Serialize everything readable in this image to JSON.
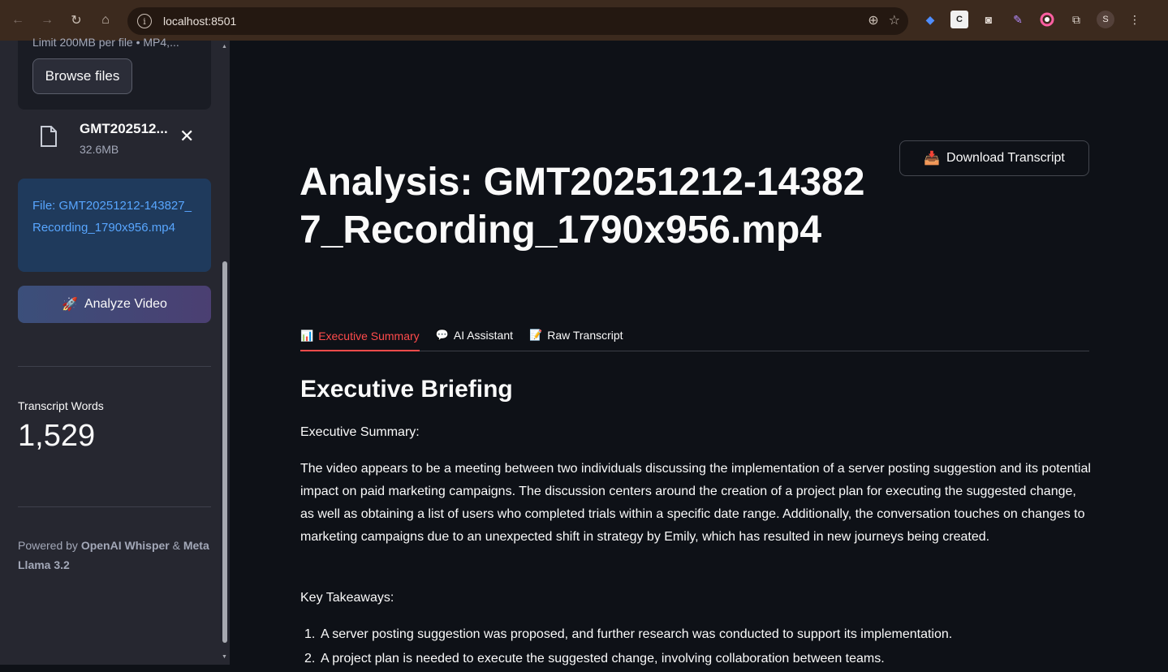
{
  "browser": {
    "url": "localhost:8501",
    "profile_initial": "S"
  },
  "sidebar": {
    "upload_limit": "Limit 200MB per file • MP4,...",
    "browse_label": "Browse files",
    "file_name": "GMT202512...",
    "file_size": "32.6MB",
    "file_info": "File: GMT20251212-143827_Recording_1790x956.mp4",
    "analyze_label": "Analyze Video",
    "metric_label": "Transcript Words",
    "metric_value": "1,529",
    "powered_prefix": "Powered by ",
    "powered_bold1": "OpenAI Whisper",
    "powered_mid": " & ",
    "powered_bold2": "Meta Llama 3.2"
  },
  "main": {
    "download_label": "Download Transcript",
    "title": "Analysis: GMT20251212-143827_Recording_1790x956.mp4",
    "tabs": [
      {
        "label": "Executive Summary",
        "active": true
      },
      {
        "label": "AI Assistant",
        "active": false
      },
      {
        "label": "Raw Transcript",
        "active": false
      }
    ],
    "section_title": "Executive Briefing",
    "summary_heading": "Executive Summary:",
    "summary_paragraph": "The video appears to be a meeting between two individuals discussing the implementation of a server posting suggestion and its potential impact on paid marketing campaigns. The discussion centers around the creation of a project plan for executing the suggested change, as well as obtaining a list of users who completed trials within a specific date range. Additionally, the conversation touches on changes to marketing campaigns due to an unexpected shift in strategy by Emily, which has resulted in new journeys being created.",
    "takeaways_heading": "Key Takeaways:",
    "takeaways": [
      "A server posting suggestion was proposed, and further research was conducted to support its implementation.",
      "A project plan is needed to execute the suggested change, involving collaboration between teams."
    ]
  },
  "colors": {
    "accent": "#ff4b4b",
    "link": "#58a6ff",
    "sidebar_bg": "#262730",
    "main_bg": "#0e1117"
  }
}
